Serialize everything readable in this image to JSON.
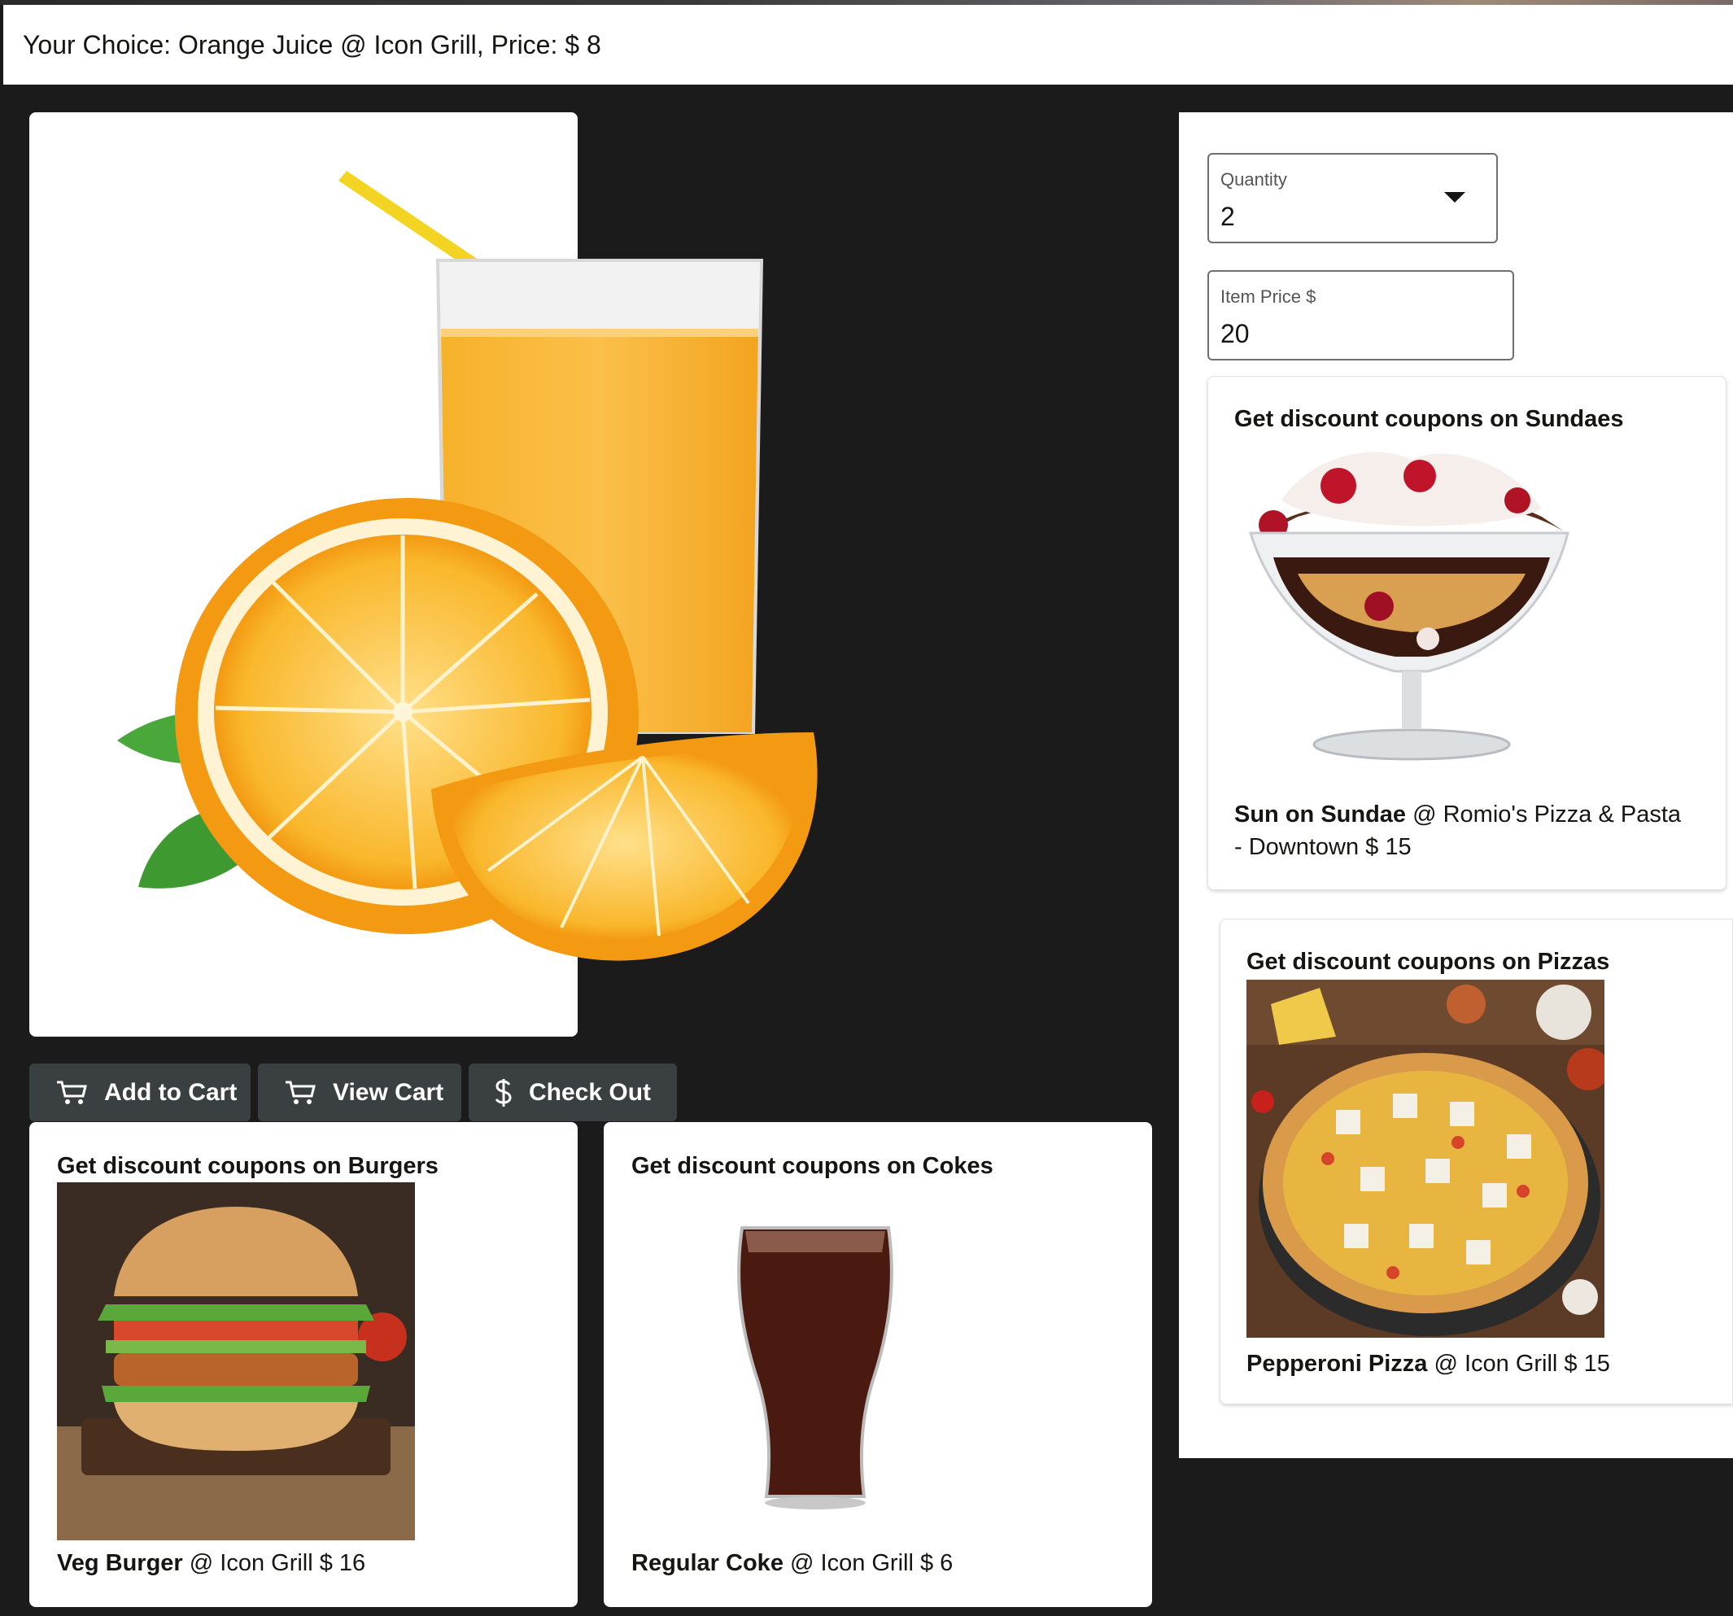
{
  "header": {
    "choice_text": "Your Choice: Orange Juice @ Icon Grill, Price: $ 8"
  },
  "hero": {
    "image_icon": "orange-juice-glass-image"
  },
  "actions": {
    "add_to_cart": "Add to Cart",
    "view_cart": "View Cart",
    "check_out": "Check Out"
  },
  "form": {
    "quantity_label": "Quantity",
    "quantity_value": "2",
    "price_label": "Item Price $",
    "price_value": "20"
  },
  "coupons": {
    "sundaes": {
      "title": "Get discount coupons on Sundaes",
      "item": "Sun on Sundae",
      "rest": " @ Romio's Pizza & Pasta - Downtown $ 15"
    },
    "pizzas": {
      "title": "Get discount coupons on Pizzas",
      "item": "Pepperoni Pizza",
      "rest": " @ Icon Grill $ 15"
    },
    "burgers": {
      "title": "Get discount coupons on Burgers",
      "item": "Veg Burger",
      "rest": " @ Icon Grill $ 16"
    },
    "cokes": {
      "title": "Get discount coupons on Cokes",
      "item": "Regular Coke",
      "rest": " @ Icon Grill $ 6"
    }
  },
  "colors": {
    "button_bg": "#3a3f41",
    "page_bg": "#1b1b1b",
    "card_bg": "#ffffff"
  }
}
